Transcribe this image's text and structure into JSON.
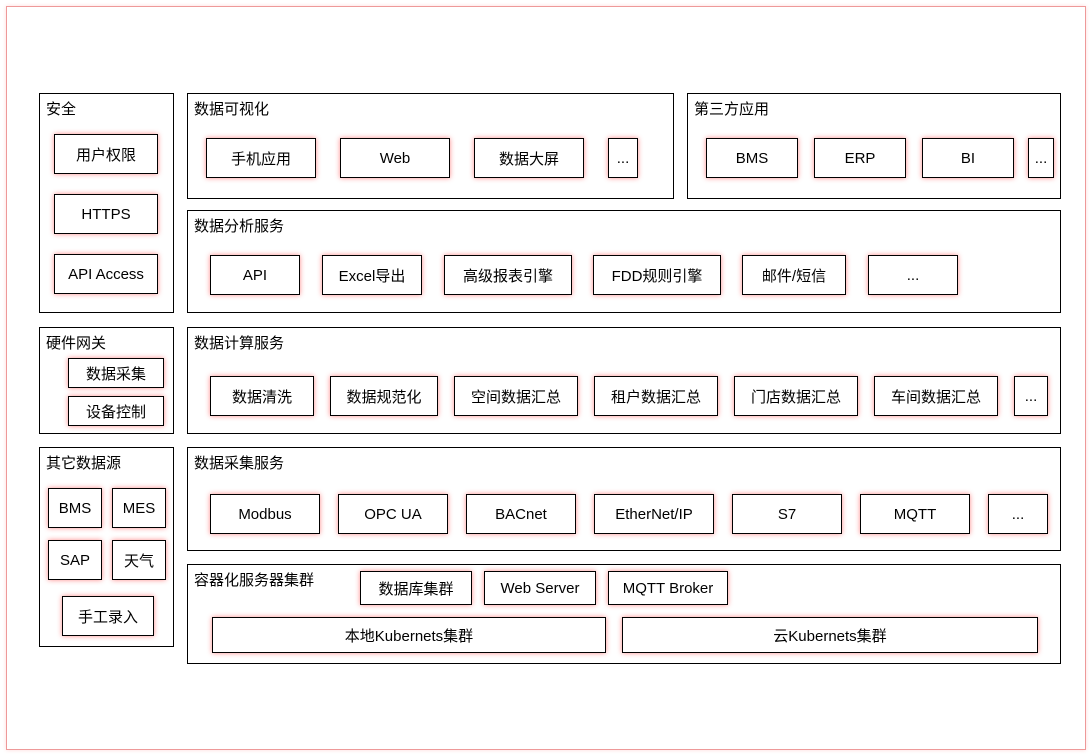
{
  "security": {
    "title": "安全",
    "items": [
      "用户权限",
      "HTTPS",
      "API Access"
    ]
  },
  "gateway": {
    "title": "硬件网关",
    "items": [
      "数据采集",
      "设备控制"
    ]
  },
  "otherSources": {
    "title": "其它数据源",
    "items": [
      "BMS",
      "MES",
      "SAP",
      "天气",
      "手工录入"
    ]
  },
  "visualization": {
    "title": "数据可视化",
    "items": [
      "手机应用",
      "Web",
      "数据大屏",
      "..."
    ]
  },
  "thirdParty": {
    "title": "第三方应用",
    "items": [
      "BMS",
      "ERP",
      "BI",
      "..."
    ]
  },
  "analysis": {
    "title": "数据分析服务",
    "items": [
      "API",
      "Excel导出",
      "高级报表引擎",
      "FDD规则引擎",
      "邮件/短信",
      "..."
    ]
  },
  "compute": {
    "title": "数据计算服务",
    "items": [
      "数据清洗",
      "数据规范化",
      "空间数据汇总",
      "租户数据汇总",
      "门店数据汇总",
      "车间数据汇总",
      "..."
    ]
  },
  "collect": {
    "title": "数据采集服务",
    "items": [
      "Modbus",
      "OPC UA",
      "BACnet",
      "EtherNet/IP",
      "S7",
      "MQTT",
      "..."
    ]
  },
  "cluster": {
    "title": "容器化服务器集群",
    "top": [
      "数据库集群",
      "Web Server",
      "MQTT Broker"
    ],
    "bottom": [
      "本地Kubernets集群",
      "云Kubernets集群"
    ]
  }
}
